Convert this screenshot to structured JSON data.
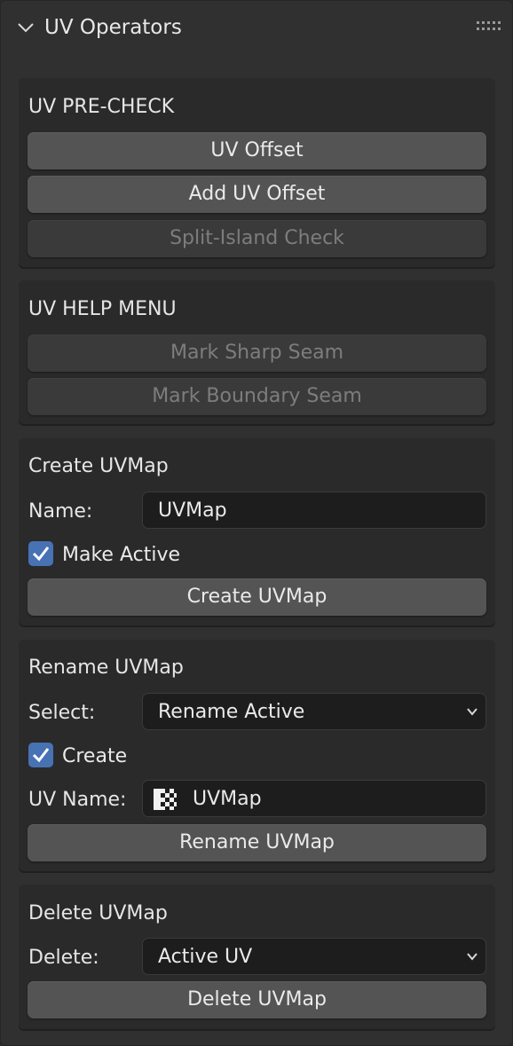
{
  "panel": {
    "title": "UV Operators",
    "collapse_icon": "chevron-down-icon",
    "grip_icon": "drag-grip-icon"
  },
  "precheck": {
    "title": "UV PRE-CHECK",
    "uv_offset": "UV Offset",
    "add_uv_offset": "Add UV Offset",
    "split_island_check": "Split-Island Check"
  },
  "help": {
    "title": "UV HELP MENU",
    "mark_sharp_seam": "Mark Sharp Seam",
    "mark_boundary_seam": "Mark Boundary Seam"
  },
  "create": {
    "title": "Create UVMap",
    "name_label": "Name:",
    "name_value": "UVMap",
    "make_active_label": "Make Active",
    "make_active_checked": true,
    "button": "Create UVMap"
  },
  "rename": {
    "title": "Rename UVMap",
    "select_label": "Select:",
    "select_value": "Rename Active",
    "create_label": "Create",
    "create_checked": true,
    "uv_name_label": "UV Name:",
    "uv_name_value": "UVMap",
    "uv_name_icon": "uv-checker-icon",
    "button": "Rename UVMap"
  },
  "delete": {
    "title": "Delete UVMap",
    "delete_label": "Delete:",
    "delete_value": "Active UV",
    "button": "Delete UVMap"
  },
  "colors": {
    "panel_bg": "#303030",
    "box_bg": "#2a2a2a",
    "button": "#545454",
    "button_disabled": "#3a3a3a",
    "field_bg": "#1d1d1d",
    "checkbox_accent": "#4772b3"
  }
}
